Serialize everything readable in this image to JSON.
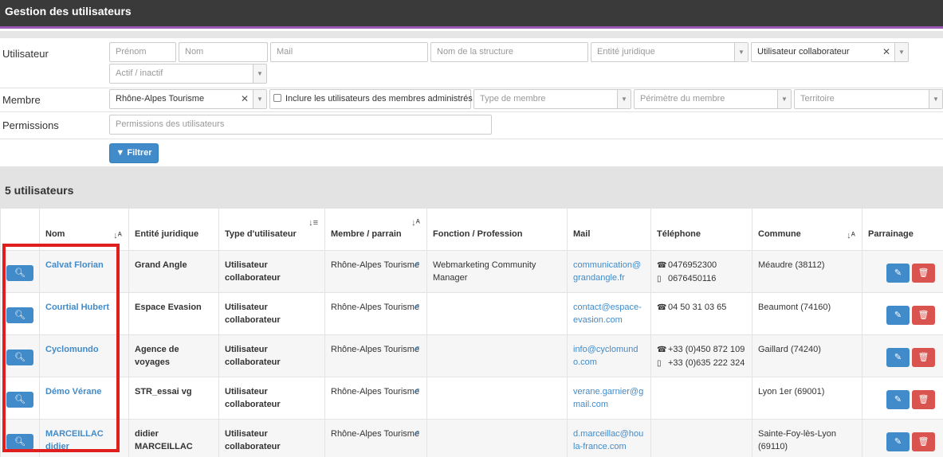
{
  "header": {
    "title": "Gestion des utilisateurs"
  },
  "filters": {
    "utilisateur_label": "Utilisateur",
    "prenom_placeholder": "Prénom",
    "nom_placeholder": "Nom",
    "mail_placeholder": "Mail",
    "structure_placeholder": "Nom de la structure",
    "entite_placeholder": "Entité juridique",
    "type_value": "Utilisateur collaborateur",
    "actif_placeholder": "Actif / inactif",
    "membre_label": "Membre",
    "membre_value": "Rhône-Alpes Tourisme",
    "inclure_label": "Inclure les utilisateurs des membres administrés",
    "type_membre_placeholder": "Type de membre",
    "perimetre_placeholder": "Périmètre du membre",
    "territoire_placeholder": "Territoire",
    "permissions_label": "Permissions",
    "permissions_placeholder": "Permissions des utilisateurs",
    "filter_button": "Filtrer"
  },
  "results": {
    "count_label": "5 utilisateurs"
  },
  "table": {
    "headers": {
      "nom": "Nom",
      "entite": "Entité juridique",
      "type": "Type d'utilisateur",
      "membre": "Membre / parrain",
      "fonction": "Fonction / Profession",
      "mail": "Mail",
      "telephone": "Téléphone",
      "commune": "Commune",
      "parrainage": "Parrainage"
    },
    "rows": [
      {
        "nom": "Calvat Florian",
        "entite": "Grand Angle",
        "type": "Utilisateur collaborateur",
        "membre": "Rhône-Alpes Tourisme",
        "fonction": "Webmarketing Community Manager",
        "mail": "communication@grandangle.fr",
        "tel1": "0476952300",
        "tel2": "0676450116",
        "commune": "Méaudre (38112)"
      },
      {
        "nom": "Courtial Hubert",
        "entite": "Espace Evasion",
        "type": "Utilisateur collaborateur",
        "membre": "Rhône-Alpes Tourisme",
        "fonction": "",
        "mail": "contact@espace-evasion.com",
        "tel1": "04 50 31 03 65",
        "tel2": "",
        "commune": "Beaumont (74160)"
      },
      {
        "nom": "Cyclomundo",
        "entite": "Agence de voyages",
        "type": "Utilisateur collaborateur",
        "membre": "Rhône-Alpes Tourisme",
        "fonction": "",
        "mail": "info@cyclomundo.com",
        "tel1": "+33 (0)450 872 109",
        "tel2": "+33 (0)635 222 324",
        "commune": "Gaillard (74240)"
      },
      {
        "nom": "Démo Vérane",
        "entite": "STR_essai vg",
        "type": "Utilisateur collaborateur",
        "membre": "Rhône-Alpes Tourisme",
        "fonction": "",
        "mail": "verane.garnier@gmail.com",
        "tel1": "",
        "tel2": "",
        "commune": "Lyon 1er (69001)"
      },
      {
        "nom": "MARCEILLAC didier",
        "entite": "didier MARCEILLAC",
        "type": "Utilisateur collaborateur",
        "membre": "Rhône-Alpes Tourisme",
        "fonction": "",
        "mail": "d.marceillac@houla-france.com",
        "tel1": "",
        "tel2": "",
        "commune": "Sainte-Foy-lès-Lyon (69110)"
      }
    ]
  },
  "icons": {
    "search": "magnifier-icon",
    "edit": "pencil-icon",
    "delete": "trash-icon",
    "external": "external-link-icon",
    "phone": "phone-icon",
    "mobile": "mobile-icon",
    "sort": "sort-alpha-icon",
    "filter": "funnel-icon"
  },
  "colors": {
    "accent": "#428bca",
    "danger": "#d9534f",
    "header_bg": "#3a3a3a",
    "header_border": "#9b59b6",
    "highlight": "#e01e1e"
  }
}
